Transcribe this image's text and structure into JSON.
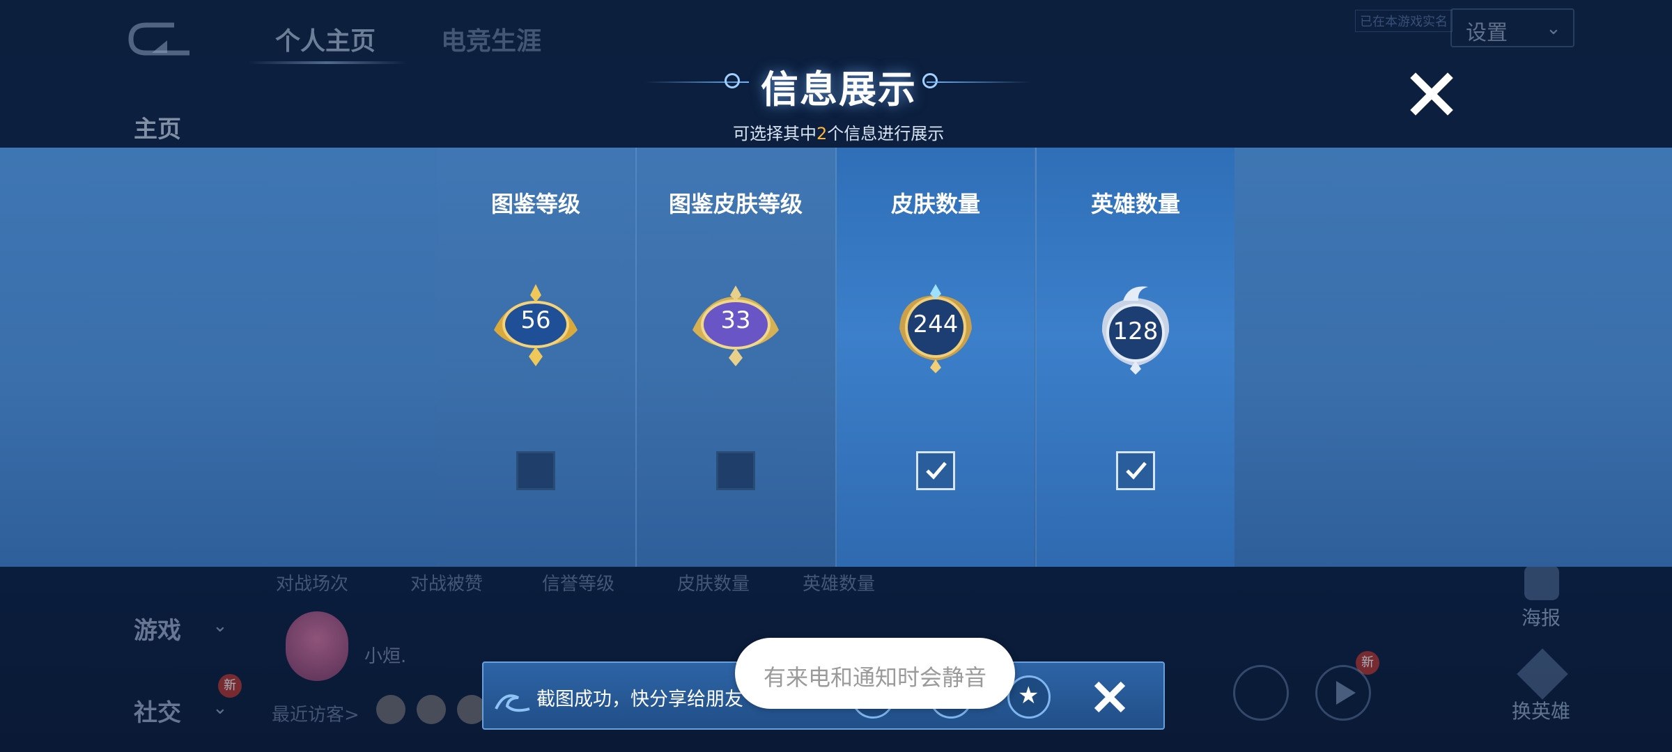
{
  "background": {
    "tabs": [
      "个人主页",
      "电竞生涯"
    ],
    "settings_label": "设置",
    "small_tag": "已在本游戏实名",
    "sidebar": {
      "home": "主页",
      "game": "游戏",
      "social": "社交"
    },
    "new_badge": "新",
    "stats_labels": [
      "对战场次",
      "对战被赞",
      "信誉等级",
      "皮肤数量",
      "英雄数量"
    ],
    "player_name": "小烜.",
    "visitors_label": "最近访客>",
    "poster_label": "海报",
    "swap_label": "换英雄"
  },
  "dialog": {
    "title": "信息展示",
    "subtitle_prefix": "可选择其中",
    "subtitle_num": "2",
    "subtitle_suffix": "个信息进行展示",
    "options": [
      {
        "label": "图鉴等级",
        "value": "56",
        "checked": false
      },
      {
        "label": "图鉴皮肤等级",
        "value": "33",
        "checked": false
      },
      {
        "label": "皮肤数量",
        "value": "244",
        "checked": true
      },
      {
        "label": "英雄数量",
        "value": "128",
        "checked": true
      }
    ]
  },
  "share_bar": {
    "text": "截图成功，快分享给朋友",
    "icons": [
      "wechat-icon",
      "moments-icon",
      "qzone-icon"
    ]
  },
  "mute_toast": {
    "text": "有来电和通知时会静音"
  },
  "colors": {
    "accent": "#ffb43d",
    "panel": "#3a6fab",
    "selected_card": "#3c7fca"
  }
}
